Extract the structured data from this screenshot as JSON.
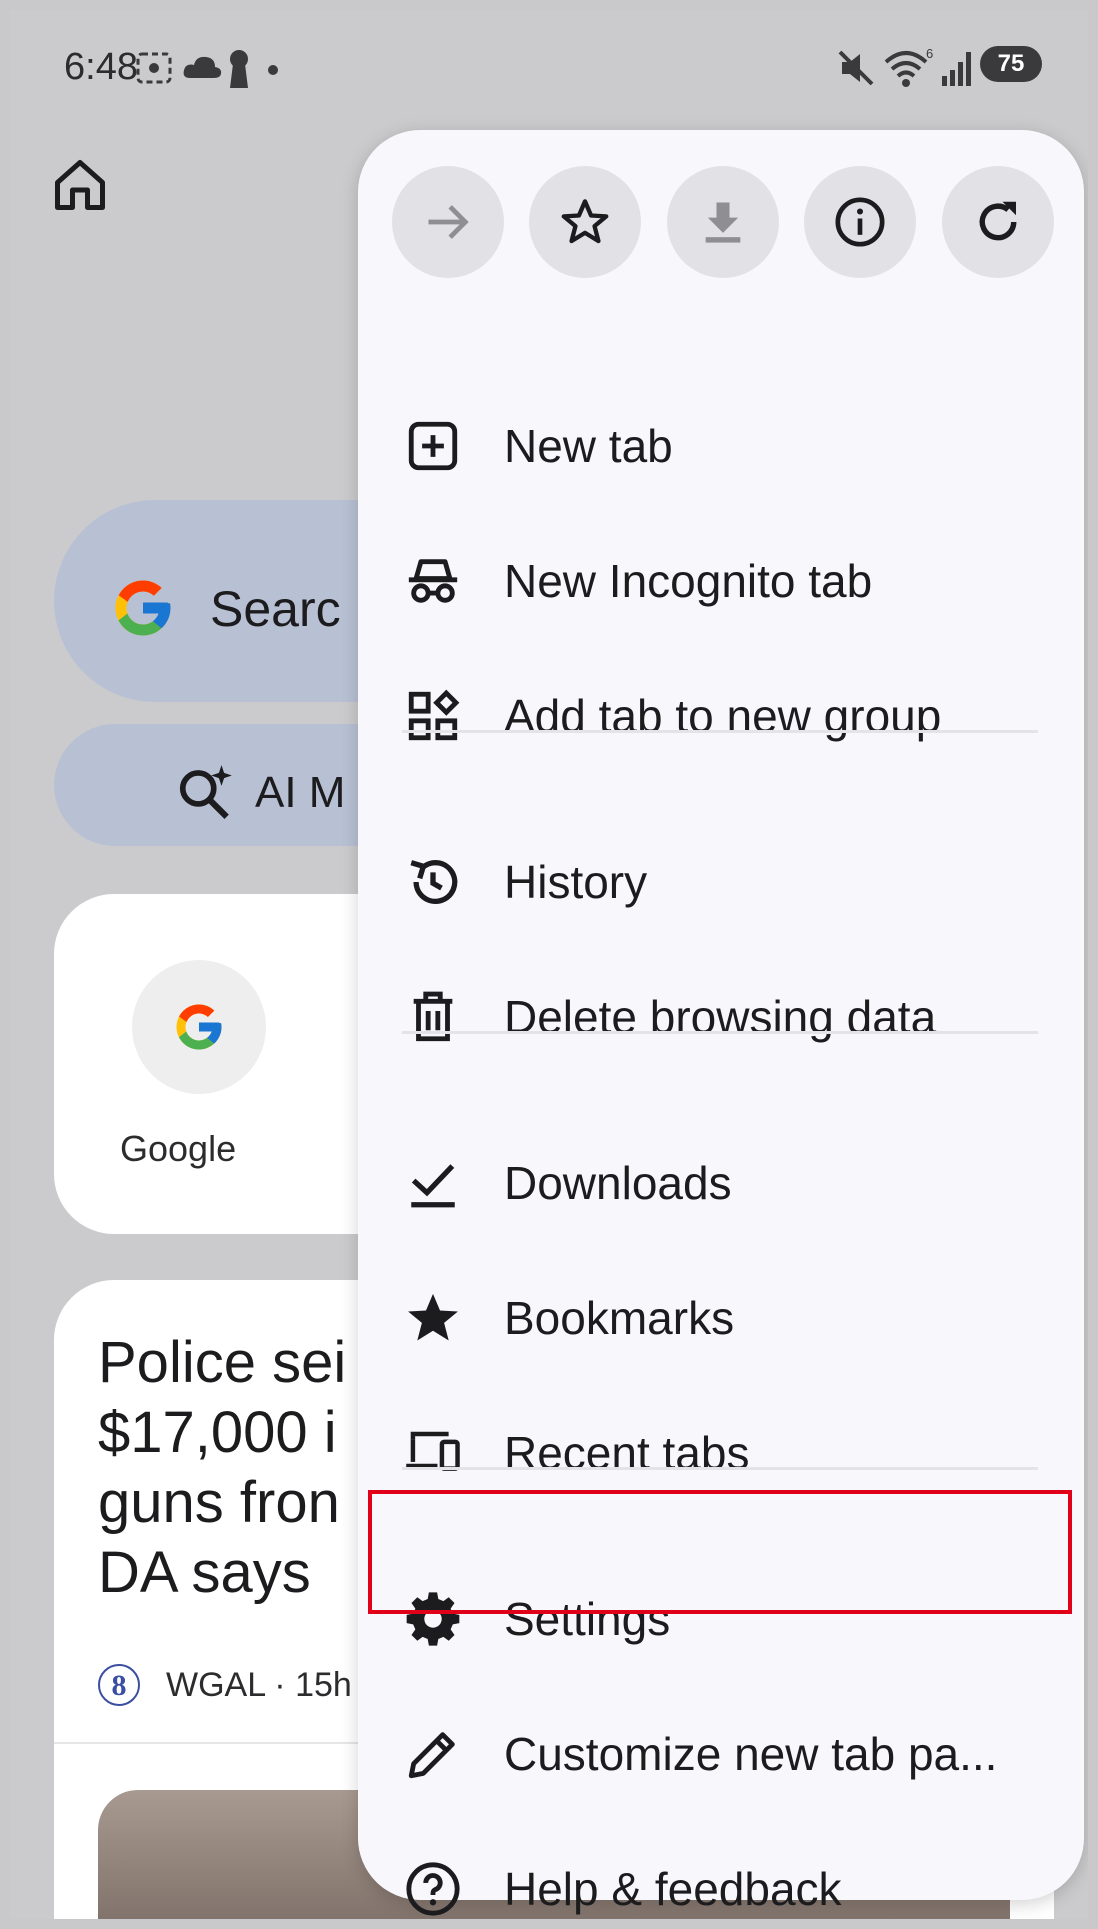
{
  "status_bar": {
    "time": "6:48",
    "battery": "75",
    "network_badge": "6"
  },
  "background": {
    "search_text": "Searc",
    "ai_text": "AI M",
    "shortcut_label": "Google",
    "news_headline": "Police sei\n$17,000 i\nguns fron\nDA says",
    "news_source": "WGAL · 15h"
  },
  "toolbar": {
    "forward": "arrow-right-icon",
    "bookmark": "star-outline-icon",
    "download": "download-icon",
    "info": "info-icon",
    "reload": "reload-icon"
  },
  "menu": {
    "items": [
      {
        "label": "New tab",
        "icon": "new-tab-icon"
      },
      {
        "label": "New Incognito tab",
        "icon": "incognito-icon"
      },
      {
        "label": "Add tab to new group",
        "icon": "tab-group-icon"
      },
      {
        "label": "History",
        "icon": "history-icon"
      },
      {
        "label": "Delete browsing data",
        "icon": "trash-icon"
      },
      {
        "label": "Downloads",
        "icon": "downloads-check-icon"
      },
      {
        "label": "Bookmarks",
        "icon": "star-filled-icon"
      },
      {
        "label": "Recent tabs",
        "icon": "devices-icon"
      },
      {
        "label": "Settings",
        "icon": "gear-icon"
      },
      {
        "label": "Customize new tab pa...",
        "icon": "pencil-icon"
      },
      {
        "label": "Help & feedback",
        "icon": "help-icon"
      }
    ]
  },
  "colors": {
    "highlight": "#e1001a",
    "menu_bg": "#f8f8fc",
    "pill_bg": "#b8c1d4"
  }
}
